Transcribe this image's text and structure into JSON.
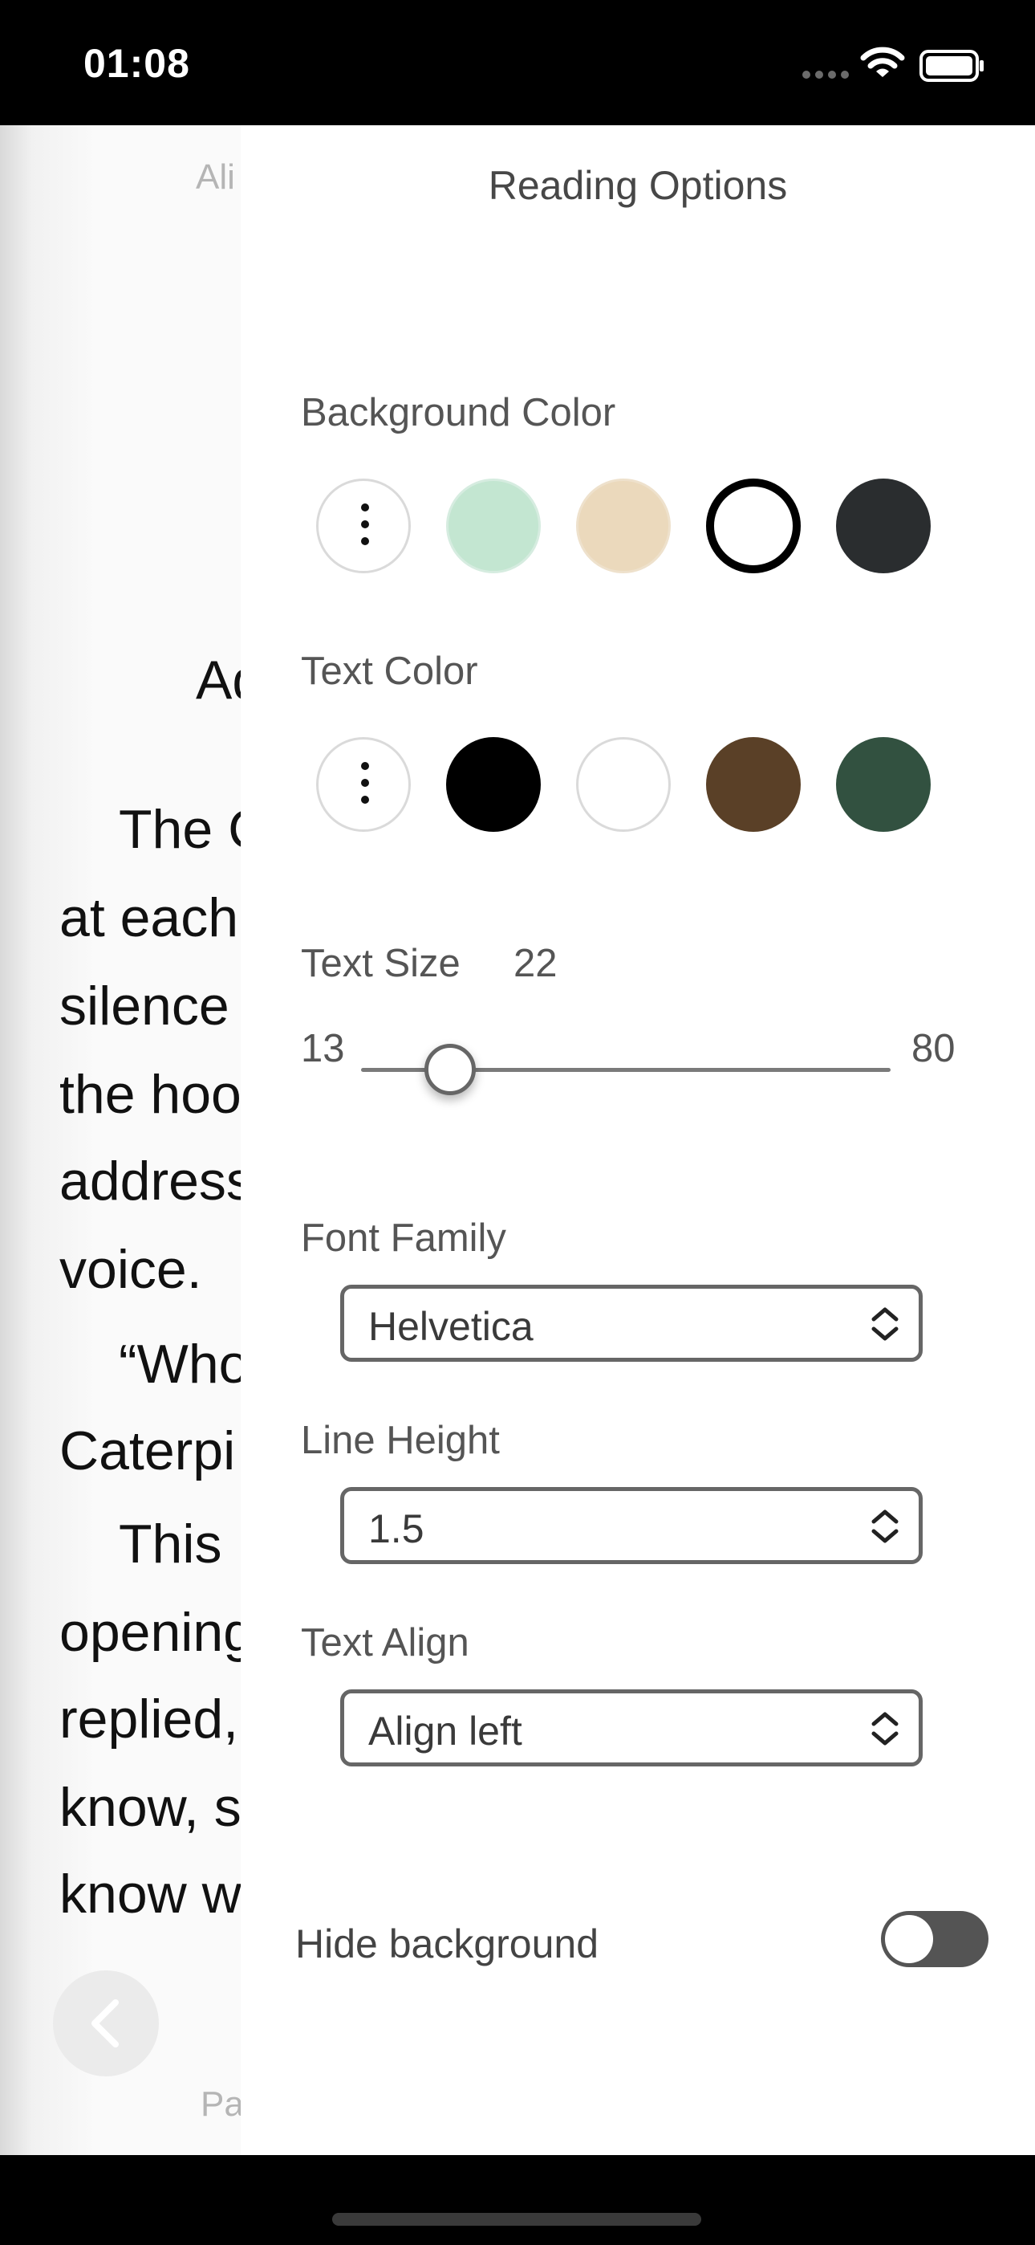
{
  "status_bar": {
    "time": "01:08",
    "icons": [
      "cellular-icon",
      "wifi-icon",
      "battery-icon"
    ]
  },
  "reader": {
    "header": "Ali",
    "chapter_fragment": "Ad",
    "lines": [
      "The C",
      "at each",
      "silence",
      "the hoo",
      "address",
      "voice.",
      "“Who",
      "Caterpi",
      "This",
      "opening",
      "replied,",
      "know, s",
      "know w"
    ],
    "footer": "Pa",
    "back_icon": "chevron-left-icon"
  },
  "panel": {
    "title": "Reading Options",
    "background_color": {
      "label": "Background Color",
      "swatches": [
        "more",
        "#c3e6d1",
        "#ebd9bc",
        "#ffffff",
        "#2a2d2f"
      ],
      "selected_index": 3
    },
    "text_color": {
      "label": "Text Color",
      "swatches": [
        "more",
        "#000000",
        "#ffffff",
        "#5a4027",
        "#325140"
      ]
    },
    "text_size": {
      "label": "Text Size",
      "value": "22",
      "min": "13",
      "max": "80"
    },
    "font_family": {
      "label": "Font Family",
      "value": "Helvetica"
    },
    "line_height": {
      "label": "Line Height",
      "value": "1.5"
    },
    "text_align": {
      "label": "Text Align",
      "value": "Align left"
    },
    "hide_background": {
      "label": "Hide background",
      "on": false
    }
  }
}
